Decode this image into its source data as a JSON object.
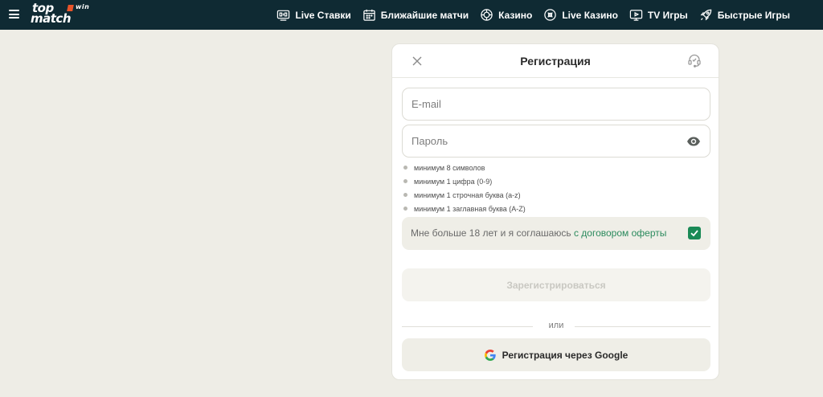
{
  "header": {
    "logo": {
      "line1": "top",
      "line2": "match",
      "suffix": "win"
    },
    "nav": [
      {
        "label": "Live Ставки",
        "icon": "live-bets-icon"
      },
      {
        "label": "Ближайшие матчи",
        "icon": "calendar-icon"
      },
      {
        "label": "Казино",
        "icon": "casino-chip-icon"
      },
      {
        "label": "Live Казино",
        "icon": "live-casino-icon"
      },
      {
        "label": "TV Игры",
        "icon": "tv-icon"
      },
      {
        "label": "Быстрые Игры",
        "icon": "rocket-icon"
      }
    ]
  },
  "modal": {
    "title": "Регистрация",
    "email_placeholder": "E-mail",
    "password_placeholder": "Пароль",
    "rules": [
      "минимум 8 символов",
      "минимум 1 цифра (0-9)",
      "минимум 1 строчная буква (a-z)",
      "минимум 1 заглавная буква (A-Z)"
    ],
    "agree_text": "Мне больше 18 лет и я соглашаюсь ",
    "agree_link": "с договором оферты",
    "agree_checked": true,
    "submit_label": "Зарегистрироваться",
    "or_label": "или",
    "google_label": "Регистрация через Google"
  },
  "colors": {
    "topbar": "#0f2a33",
    "page_bg": "#eeede6",
    "accent_green": "#1a8a56",
    "link_green": "#2b8a5d"
  }
}
